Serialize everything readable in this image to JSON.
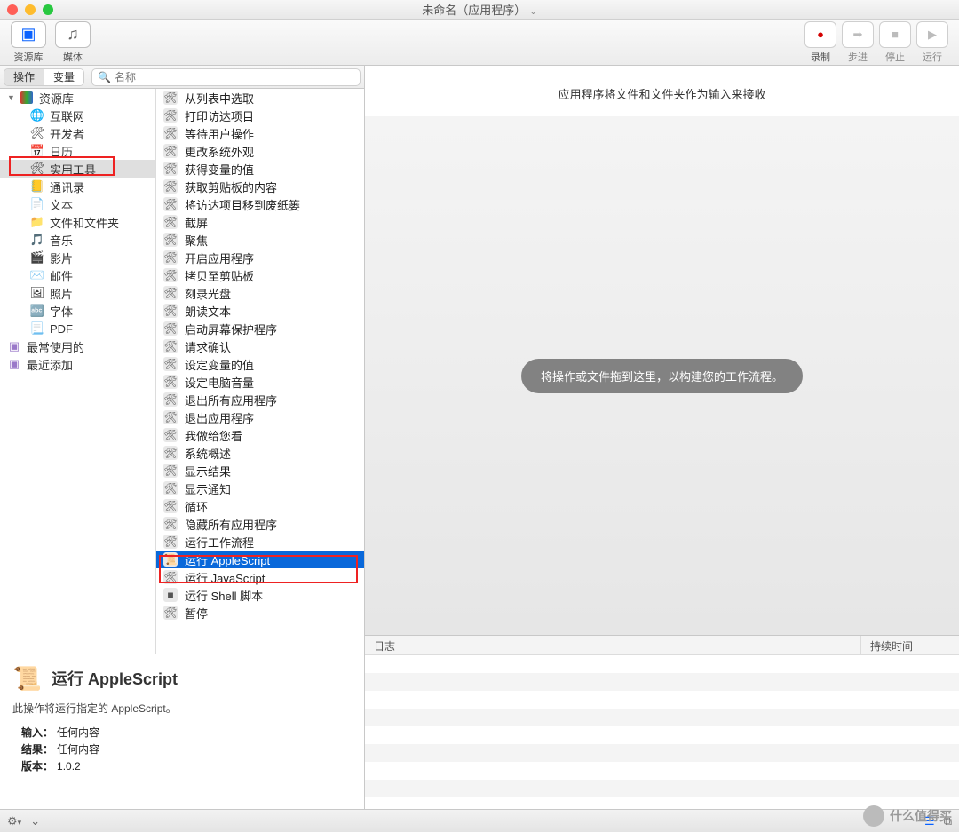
{
  "window": {
    "title": "未命名（应用程序）"
  },
  "toolbar": {
    "left": [
      {
        "label": "资源库",
        "icon": "▣"
      },
      {
        "label": "媒体",
        "icon": "♫"
      }
    ],
    "right": [
      {
        "label": "录制",
        "icon": "●",
        "color": "#d40000"
      },
      {
        "label": "步进",
        "icon": "➡",
        "disabled": true
      },
      {
        "label": "停止",
        "icon": "■",
        "disabled": true
      },
      {
        "label": "运行",
        "icon": "▶",
        "disabled": true
      }
    ]
  },
  "tabs": {
    "active": "操作",
    "items": [
      "操作",
      "变量"
    ]
  },
  "search": {
    "placeholder": "名称"
  },
  "library": {
    "root": "资源库",
    "categories": [
      {
        "label": "互联网",
        "icon": "🌐"
      },
      {
        "label": "开发者",
        "icon": "🛠"
      },
      {
        "label": "日历",
        "icon": "📅"
      },
      {
        "label": "实用工具",
        "icon": "🛠",
        "selected": true,
        "highlight": true
      },
      {
        "label": "通讯录",
        "icon": "📒"
      },
      {
        "label": "文本",
        "icon": "📄"
      },
      {
        "label": "文件和文件夹",
        "icon": "📁"
      },
      {
        "label": "音乐",
        "icon": "🎵"
      },
      {
        "label": "影片",
        "icon": "🎬"
      },
      {
        "label": "邮件",
        "icon": "✉️"
      },
      {
        "label": "照片",
        "icon": "🖼"
      },
      {
        "label": "字体",
        "icon": "🔤"
      },
      {
        "label": "PDF",
        "icon": "📃"
      }
    ],
    "extras": [
      {
        "label": "最常使用的"
      },
      {
        "label": "最近添加"
      }
    ]
  },
  "actions": [
    "从列表中选取",
    "打印访达项目",
    "等待用户操作",
    "更改系统外观",
    "获得变量的值",
    "获取剪贴板的内容",
    "将访达项目移到废纸篓",
    "截屏",
    "聚焦",
    "开启应用程序",
    "拷贝至剪贴板",
    "刻录光盘",
    "朗读文本",
    "启动屏幕保护程序",
    "请求确认",
    "设定变量的值",
    "设定电脑音量",
    "退出所有应用程序",
    "退出应用程序",
    "我做给您看",
    "系统概述",
    "显示结果",
    "显示通知",
    "循环",
    "隐藏所有应用程序",
    "运行工作流程",
    "运行 AppleScript",
    "运行 JavaScript",
    "运行 Shell 脚本",
    "暂停"
  ],
  "selected_action_index": 26,
  "details": {
    "title": "运行 AppleScript",
    "desc": "此操作将运行指定的 AppleScript。",
    "input_label": "输入：",
    "input_value": "任何内容",
    "result_label": "结果：",
    "result_value": "任何内容",
    "version_label": "版本：",
    "version_value": "1.0.2"
  },
  "workflow": {
    "header": "应用程序将文件和文件夹作为输入来接收",
    "hint": "将操作或文件拖到这里，以构建您的工作流程。"
  },
  "log": {
    "col1": "日志",
    "col2": "持续时间"
  },
  "watermark": "什么值得买"
}
